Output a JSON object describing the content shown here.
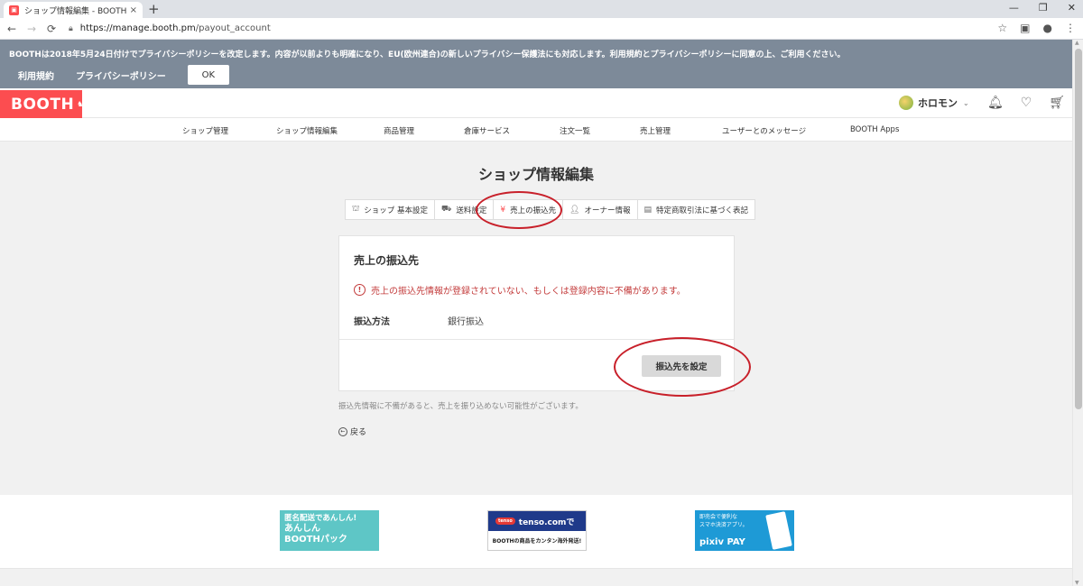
{
  "browser": {
    "tab_title": "ショップ情報編集 - BOOTH",
    "tab_close": "×",
    "new_tab": "+",
    "url_host": "https://manage.booth.pm",
    "url_path": "/payout_account"
  },
  "privacy_banner": {
    "text": "BOOTHは2018年5月24日付けでプライバシーポリシーを改定します。内容が以前よりも明確になり、EU(欧州連合)の新しいプライバシー保護法にも対応します。利用規約とプライバシーポリシーに同意の上、ご利用ください。",
    "terms_link": "利用規約",
    "privacy_link": "プライバシーポリシー",
    "ok_label": "OK"
  },
  "header": {
    "logo": "BOOTH",
    "user_name": "ホロモン"
  },
  "nav": {
    "items": [
      "ショップ管理",
      "ショップ情報編集",
      "商品管理",
      "倉庫サービス",
      "注文一覧",
      "売上管理",
      "ユーザーとのメッセージ",
      "BOOTH Apps"
    ]
  },
  "page": {
    "title": "ショップ情報編集",
    "tabs": [
      "ショップ 基本設定",
      "送料設定",
      "売上の振込先",
      "オーナー情報",
      "特定商取引法に基づく表記"
    ],
    "active_tab": "売上の振込先",
    "card_title": "売上の振込先",
    "warning": "売上の振込先情報が登録されていない、もしくは登録内容に不備があります。",
    "method_label": "振込方法",
    "method_value": "銀行振込",
    "setup_button": "振込先を設定",
    "note": "振込先情報に不備があると、売上を振り込めない可能性がございます。",
    "back_label": "戻る"
  },
  "footer": {
    "ad1_line1": "匿名配送であんしん!",
    "ad1_line2": "あんしん",
    "ad1_line3": "BOOTHパック",
    "ad2_top": "tenso.comで",
    "ad2_badge": "tenso",
    "ad2_bottom": "BOOTHの商品をカンタン海外発送!",
    "ad3_line1": "即売会で便利な",
    "ad3_line2": "スマホ決済アプリ。",
    "ad3_brand": "pixiv PAY"
  },
  "colors": {
    "brand": "#fc4d50",
    "banner_bg": "#7d8a99",
    "warning": "#c33b3b",
    "annotation": "#c8202a"
  }
}
